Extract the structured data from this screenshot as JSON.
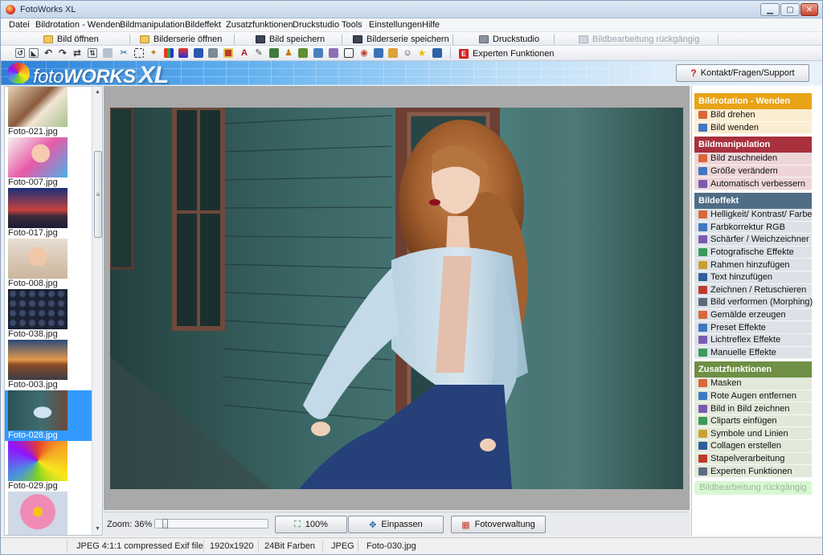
{
  "window": {
    "title": "FotoWorks XL"
  },
  "menu": [
    "Datei",
    "Bildrotation - Wenden",
    "Bildmanipulation",
    "Bildeffekt",
    "Zusatzfunktionen",
    "Druckstudio",
    "Tools",
    "Einstellungen",
    "Hilfe"
  ],
  "toolbar": {
    "open": "Bild öffnen",
    "open_series": "Bilderserie öffnen",
    "save": "Bild speichern",
    "save_series": "Bilderserie speichern",
    "print": "Druckstudio",
    "undo": "Bildbearbeitung rückgängig",
    "expert": "Experten Funktionen"
  },
  "banner": {
    "contact": "Kontakt/Fragen/Support"
  },
  "thumbnails": [
    "Foto-021.jpg",
    "Foto-007.jpg",
    "Foto-017.jpg",
    "Foto-008.jpg",
    "Foto-038.jpg",
    "Foto-003.jpg",
    "Foto-028.jpg",
    "Foto-029.jpg",
    ""
  ],
  "selected_thumbnail": "Foto-028.jpg",
  "zoom": {
    "label": "Zoom: 36%",
    "value_percent": 36,
    "btn_100": "100%",
    "btn_fit": "Einpassen",
    "btn_manager": "Fotoverwaltung"
  },
  "sidebar": {
    "rotation": {
      "title": "Bildrotation - Wenden",
      "color": "#e8a317",
      "items": [
        "Bild drehen",
        "Bild wenden"
      ]
    },
    "manipulation": {
      "title": "Bildmanipulation",
      "color": "#a8313d",
      "items": [
        "Bild zuschneiden",
        "Größe verändern",
        "Automatisch verbessern"
      ]
    },
    "effect": {
      "title": "Bildeffekt",
      "color": "#506d86",
      "items": [
        "Helligkeit/ Kontrast/ Farbe",
        "Farbkorrektur RGB",
        "Schärfer / Weichzeichner",
        "Fotografische Effekte",
        "Rahmen hinzufügen",
        "Text hinzufügen",
        "Zeichnen / Retuschieren",
        "Bild verformen (Morphing)",
        "Gemälde erzeugen",
        "Preset Effekte",
        "Lichtreflex Effekte",
        "Manuelle Effekte"
      ]
    },
    "extra": {
      "title": "Zusatzfunktionen",
      "color": "#6f8f45",
      "items": [
        "Masken",
        "Rote Augen entfernen",
        "Bild in Bild zeichnen",
        "Cliparts einfügen",
        "Symbole und Linien",
        "Collagen erstellen",
        "Stapelverarbeitung",
        "Experten Funktionen"
      ]
    },
    "undo": "Bildbearbeitung rückgängig"
  },
  "status": {
    "format": "JPEG 4:1:1 compressed Exif file",
    "dimensions": "1920x1920",
    "depth": "24Bit Farben",
    "type": "JPEG",
    "file": "Foto-030.jpg"
  }
}
